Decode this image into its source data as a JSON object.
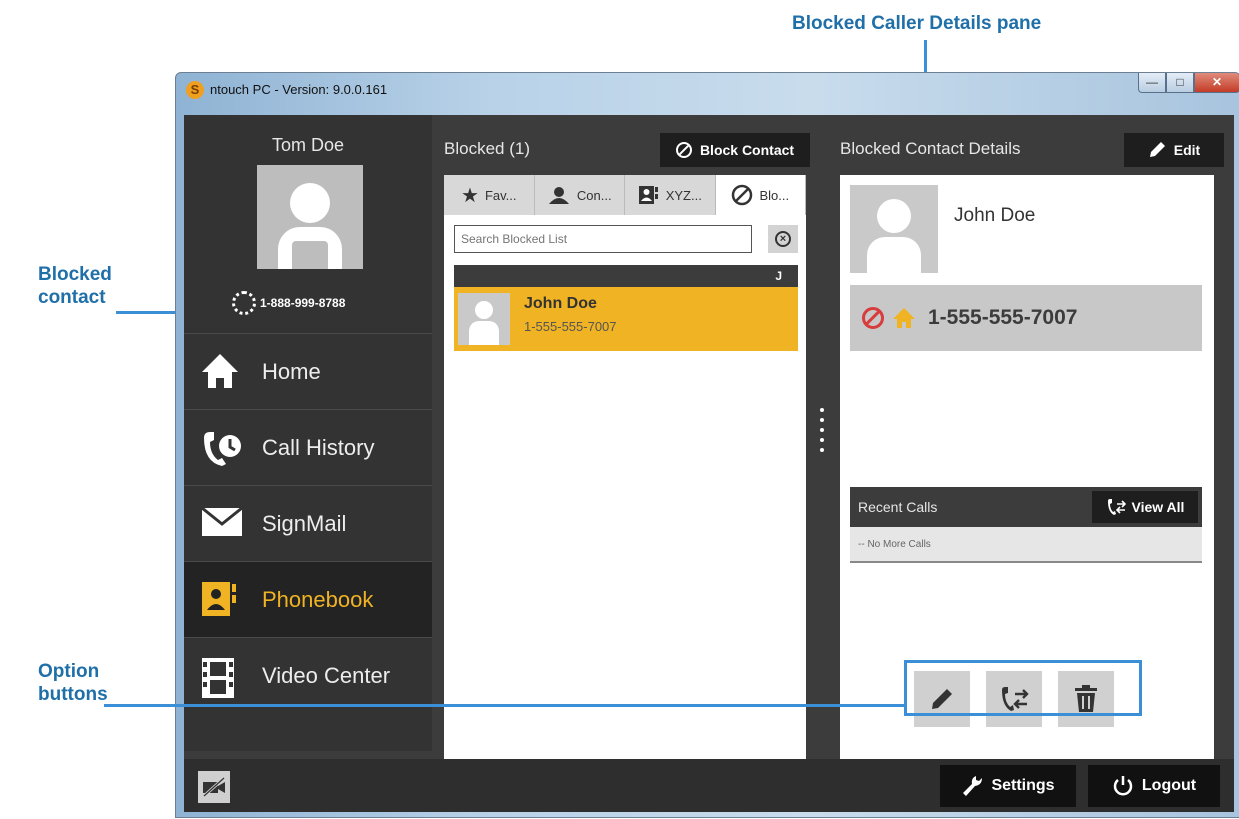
{
  "callouts": {
    "details_pane": "Blocked Caller Details pane",
    "blocked_contact_line1": "Blocked",
    "blocked_contact_line2": "contact",
    "option_buttons_line1": "Option",
    "option_buttons_line2": "buttons"
  },
  "window": {
    "title": "ntouch PC  -  Version: 9.0.0.161",
    "controls": [
      "minimize",
      "maximize",
      "close"
    ]
  },
  "user": {
    "name": "Tom Doe",
    "phone": "1-888-999-8788"
  },
  "nav": [
    {
      "label": "Home",
      "icon": "home-icon"
    },
    {
      "label": "Call History",
      "icon": "call-history-icon"
    },
    {
      "label": "SignMail",
      "icon": "envelope-icon"
    },
    {
      "label": "Phonebook",
      "icon": "phonebook-icon",
      "active": true
    },
    {
      "label": "Video Center",
      "icon": "film-icon"
    }
  ],
  "blocked_list": {
    "title": "Blocked (1)",
    "block_button": "Block Contact",
    "tabs": [
      {
        "label": "Fav...",
        "icon": "star-icon"
      },
      {
        "label": "Con...",
        "icon": "contacts-icon"
      },
      {
        "label": "XYZ...",
        "icon": "phonebook-icon"
      },
      {
        "label": "Blo...",
        "icon": "block-icon",
        "active": true
      }
    ],
    "search_placeholder": "Search Blocked List",
    "group_letter": "J",
    "contacts": [
      {
        "name": "John Doe",
        "phone": "1-555-555-7007"
      }
    ]
  },
  "details": {
    "title": "Blocked Contact Details",
    "edit_button": "Edit",
    "name": "John Doe",
    "phone": "1-555-555-7007",
    "recent_calls_title": "Recent Calls",
    "view_all_button": "View All",
    "no_calls_text": "-- No More Calls"
  },
  "bottom_bar": {
    "settings_button": "Settings",
    "logout_button": "Logout"
  },
  "colors": {
    "accent": "#f0b323",
    "callout": "#1f6fa8",
    "callout_line": "#3a8fd6",
    "block_red": "#d83c3c"
  }
}
